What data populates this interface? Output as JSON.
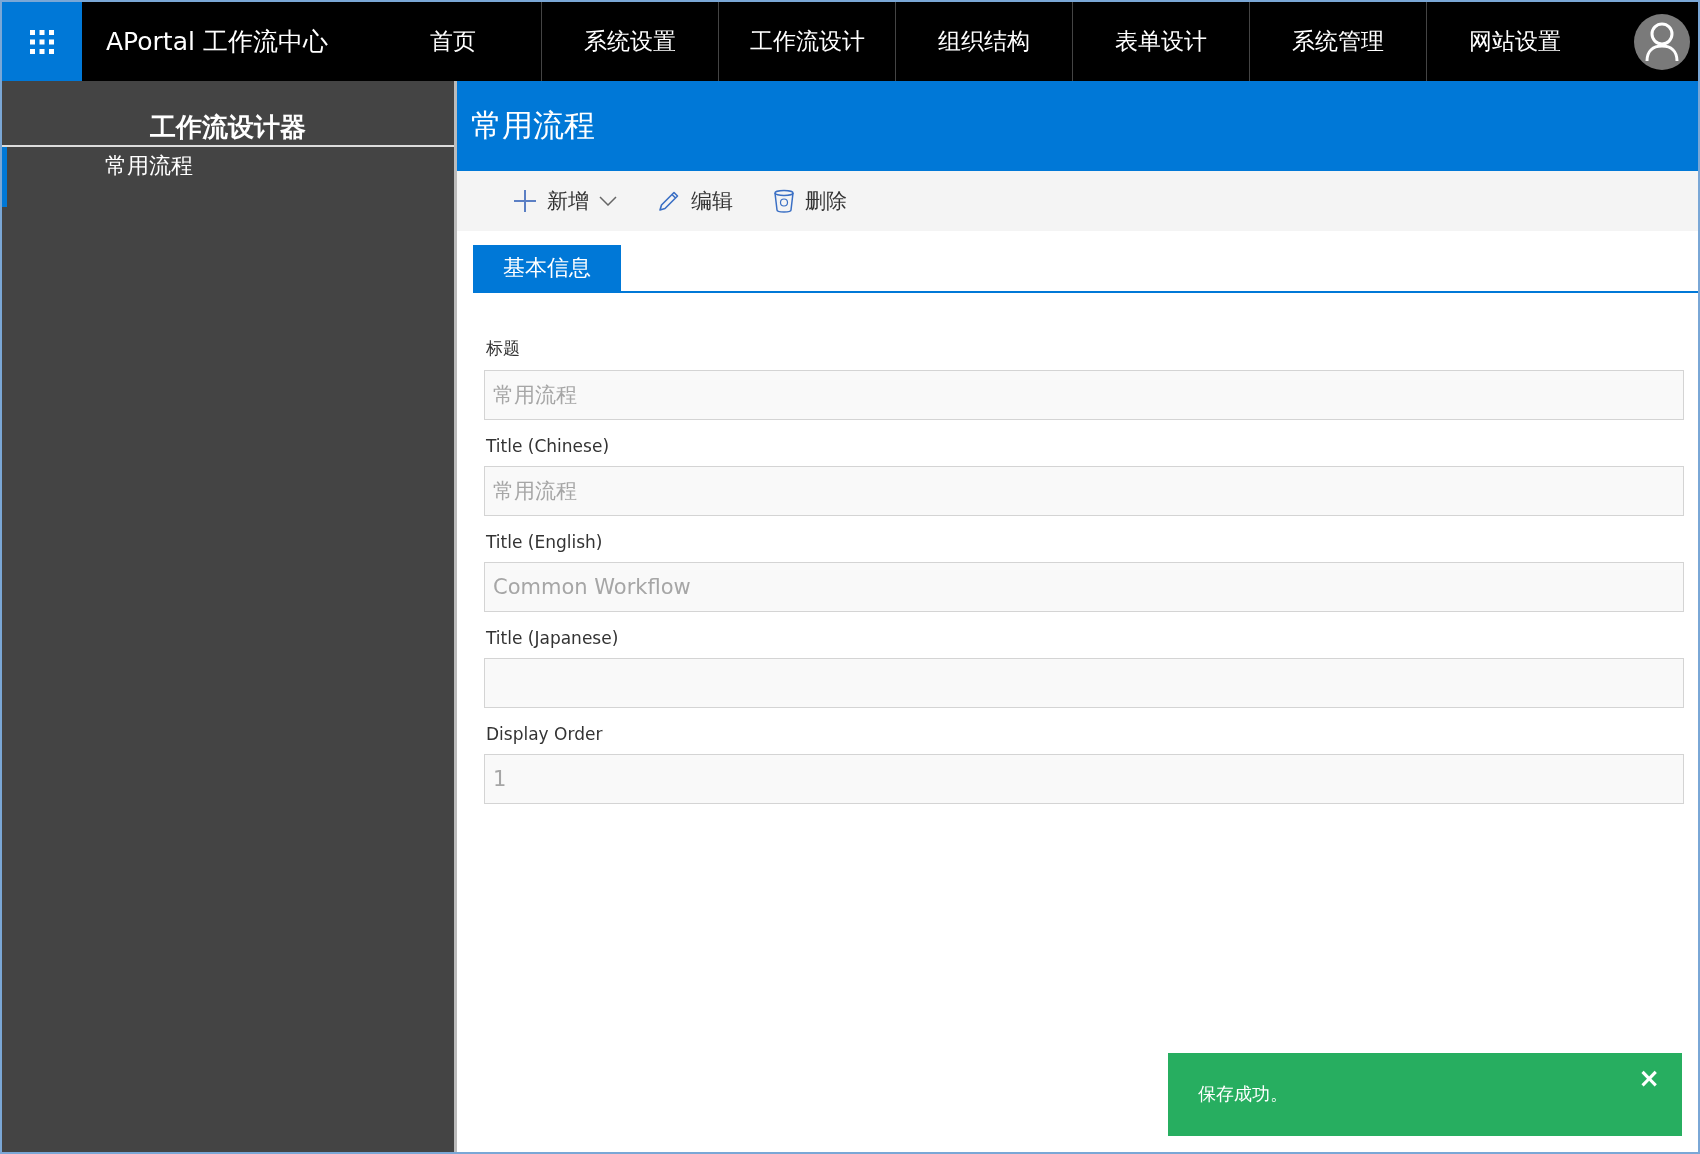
{
  "topbar": {
    "brand": "APortal 工作流中心",
    "nav": [
      {
        "label": "首页"
      },
      {
        "label": "系统设置"
      },
      {
        "label": "工作流设计"
      },
      {
        "label": "组织结构"
      },
      {
        "label": "表单设计"
      },
      {
        "label": "系统管理"
      },
      {
        "label": "网站设置"
      }
    ]
  },
  "sidebar": {
    "title": "工作流设计器",
    "items": [
      {
        "label": "常用流程",
        "selected": true
      }
    ]
  },
  "page": {
    "title": "常用流程"
  },
  "toolbar": [
    {
      "kind": "add",
      "label": "新增",
      "dropdown": true
    },
    {
      "kind": "edit",
      "label": "编辑",
      "dropdown": false
    },
    {
      "kind": "delete",
      "label": "删除",
      "dropdown": false
    }
  ],
  "tabs": [
    {
      "label": "基本信息",
      "selected": true
    }
  ],
  "fields": [
    {
      "label": "标题",
      "value": "常用流程",
      "disabled": true
    },
    {
      "label": "Title (Chinese)",
      "value": "常用流程",
      "disabled": true
    },
    {
      "label": "Title (English)",
      "value": "Common Workflow",
      "disabled": true
    },
    {
      "label": "Title (Japanese)",
      "disabled": true
    },
    {
      "label": "Display Order",
      "value": "1",
      "disabled": true
    }
  ],
  "toast": {
    "message": "保存成功。",
    "close": "×"
  }
}
